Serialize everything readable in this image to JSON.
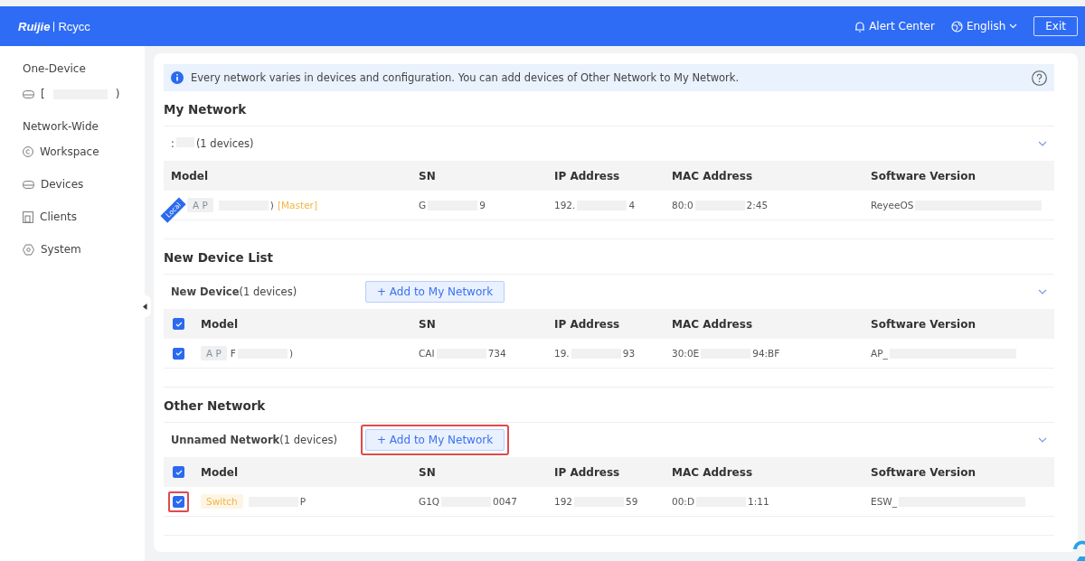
{
  "header": {
    "logo_brand": "Ruijie",
    "logo_product": "Rcycc",
    "alert": "Alert Center",
    "language": "English",
    "exit": "Exit"
  },
  "sidebar": {
    "sections": [
      {
        "title": "One-Device",
        "items": [
          {
            "head": "[",
            "tail": ")",
            "selected": false
          }
        ]
      },
      {
        "title": "Network-Wide",
        "items": [
          {
            "label": "Workspace",
            "selected": false
          },
          {
            "label": "Devices",
            "selected": false
          },
          {
            "label": "Clients",
            "selected": false
          },
          {
            "label": "System",
            "selected": false
          }
        ]
      }
    ]
  },
  "notice": "Every network varies in devices and configuration. You can add devices of Other Network to My Network.",
  "sections": [
    {
      "title": "My Network",
      "groups": [
        {
          "name_prefix": ":",
          "count": "(1 devices)",
          "expanded": true,
          "columns": [
            "Model",
            "SN",
            "IP Address",
            "MAC Address",
            "Software Version"
          ],
          "rows": [
            {
              "cells": [
                {
                  "local_label": "Local",
                  "tag": "A P",
                  "color": "#8a8f99",
                  "tail": ")",
                  "role": "[Master]"
                },
                {
                  "head": "G",
                  "tail": "9"
                },
                {
                  "head": "192.",
                  "tail": "4"
                },
                {
                  "head": "80:0",
                  "tail": "2:45"
                },
                {
                  "head": "ReyeeOS"
                }
              ]
            }
          ]
        }
      ]
    },
    {
      "title": "New Device List",
      "groups": [
        {
          "name": "New Device",
          "count": "(1 devices)",
          "expanded": true,
          "all_checked": true,
          "button": {
            "label": "+ Add to My Network",
            "highlighted": false
          },
          "columns": [
            "Model",
            "SN",
            "IP Address",
            "MAC Address",
            "Software Version"
          ],
          "rows": [
            {
              "checked": true,
              "highlighted": false,
              "cells": [
                {
                  "tag": "A P",
                  "color": "#8a8f99",
                  "head": "F",
                  "tail": ")"
                },
                {
                  "head": "CAI",
                  "tail": "734"
                },
                {
                  "head": "19.",
                  "tail": "93"
                },
                {
                  "head": "30:0E",
                  "tail": "94:BF"
                },
                {
                  "head": "AP_"
                }
              ]
            }
          ]
        }
      ]
    },
    {
      "title": "Other Network",
      "groups": [
        {
          "name": "Unnamed Network",
          "count": "(1 devices)",
          "expanded": true,
          "all_checked": true,
          "button": {
            "label": "+ Add to My Network",
            "highlighted": true
          },
          "columns": [
            "Model",
            "SN",
            "IP Address",
            "MAC Address",
            "Software Version"
          ],
          "rows": [
            {
              "checked": true,
              "highlighted": true,
              "cells": [
                {
                  "tag": "Switch",
                  "color": "#f2b640",
                  "tail": "P"
                },
                {
                  "head": "G1Q",
                  "tail": "0047"
                },
                {
                  "head": "192",
                  "tail": "59"
                },
                {
                  "head": "00:D",
                  "tail": "1:11"
                },
                {
                  "head": "ESW_"
                }
              ]
            }
          ]
        }
      ]
    }
  ]
}
